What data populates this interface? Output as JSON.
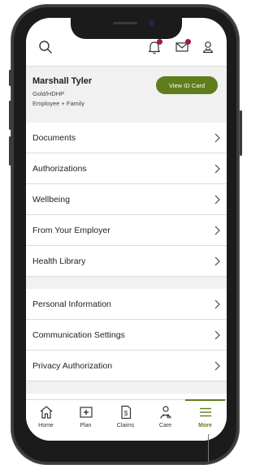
{
  "profile": {
    "name": "Marshall Tyler",
    "plan": "Gold/HDHP",
    "coverage": "Employee + Family",
    "id_card_label": "View ID Card"
  },
  "menu_group_1": [
    {
      "label": "Documents"
    },
    {
      "label": "Authorizations"
    },
    {
      "label": "Wellbeing"
    },
    {
      "label": "From Your Employer"
    },
    {
      "label": "Health Library"
    }
  ],
  "menu_group_2": [
    {
      "label": "Personal Information"
    },
    {
      "label": "Communication Settings"
    },
    {
      "label": "Privacy Authorization"
    }
  ],
  "tabs": [
    {
      "label": "Home",
      "icon": "home-icon"
    },
    {
      "label": "Plan",
      "icon": "plan-icon"
    },
    {
      "label": "Claims",
      "icon": "claims-icon"
    },
    {
      "label": "Care",
      "icon": "care-icon"
    },
    {
      "label": "More",
      "icon": "menu-icon",
      "active": true
    }
  ],
  "colors": {
    "accent": "#5f7d1a",
    "badge": "#a3174d"
  }
}
